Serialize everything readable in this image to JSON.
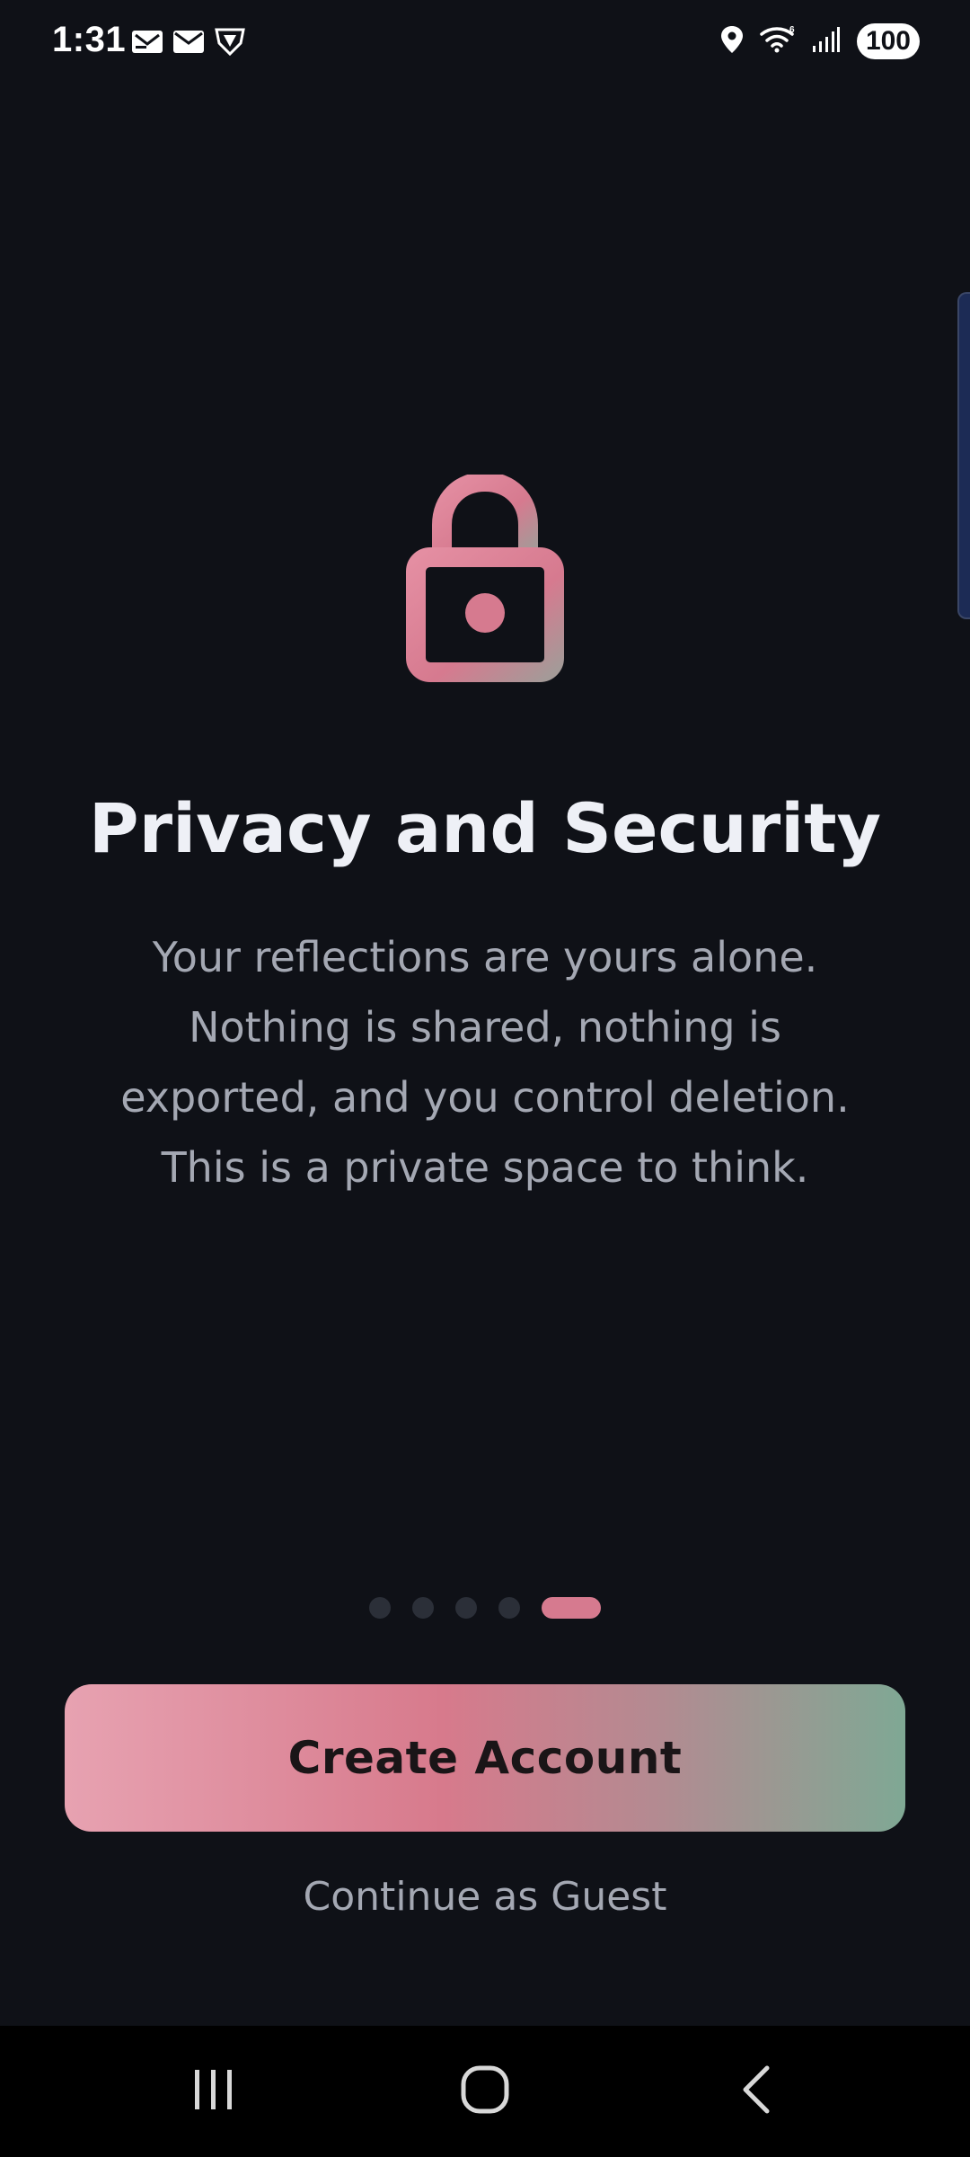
{
  "status_bar": {
    "time": "1:31",
    "battery": "100",
    "left_icons": [
      "mail-icon",
      "mail-icon",
      "vpn-shield-icon"
    ],
    "right_icons": [
      "location-icon",
      "wifi-icon",
      "signal-icon"
    ]
  },
  "slide": {
    "icon": "lock-icon",
    "title": "Privacy and Security",
    "body_lines": [
      "Your reflections are yours alone.",
      "Nothing is shared, nothing is",
      "exported, and you control deletion.",
      "This is a private space to think."
    ]
  },
  "pager": {
    "total": 5,
    "active_index": 4
  },
  "actions": {
    "create_account_label": "Create Account",
    "guest_label": "Continue as Guest"
  },
  "nav_bar": {
    "buttons": [
      "recents-icon",
      "home-icon",
      "back-icon"
    ]
  },
  "colors": {
    "background": "#0f1117",
    "accent": "#d67a8f",
    "button_gradient_start": "#e7a2b1",
    "button_gradient_end": "#7fa894"
  }
}
